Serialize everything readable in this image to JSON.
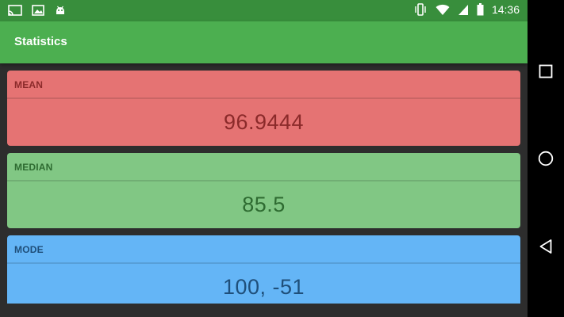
{
  "statusbar": {
    "time": "14:36",
    "icons_left": [
      "cast-icon",
      "image-icon",
      "android-icon"
    ],
    "icons_right": [
      "vibrate-icon",
      "wifi-icon",
      "signal-icon",
      "battery-icon"
    ]
  },
  "toolbar": {
    "title": "Statistics"
  },
  "cards": [
    {
      "label": "MEAN",
      "value": "96.9444",
      "color": "#e57373",
      "text_color": "#8b2a2a"
    },
    {
      "label": "MEDIAN",
      "value": "85.5",
      "color": "#81c784",
      "text_color": "#2e6b31"
    },
    {
      "label": "MODE",
      "value": "100, -51",
      "color": "#64b5f6",
      "text_color": "#1f4f7a"
    }
  ],
  "navbar": {
    "buttons": [
      "recents-button",
      "home-button",
      "back-button"
    ]
  },
  "colors": {
    "primary": "#4caf50",
    "primary_dark": "#388e3c",
    "background": "#2d2d2d"
  }
}
